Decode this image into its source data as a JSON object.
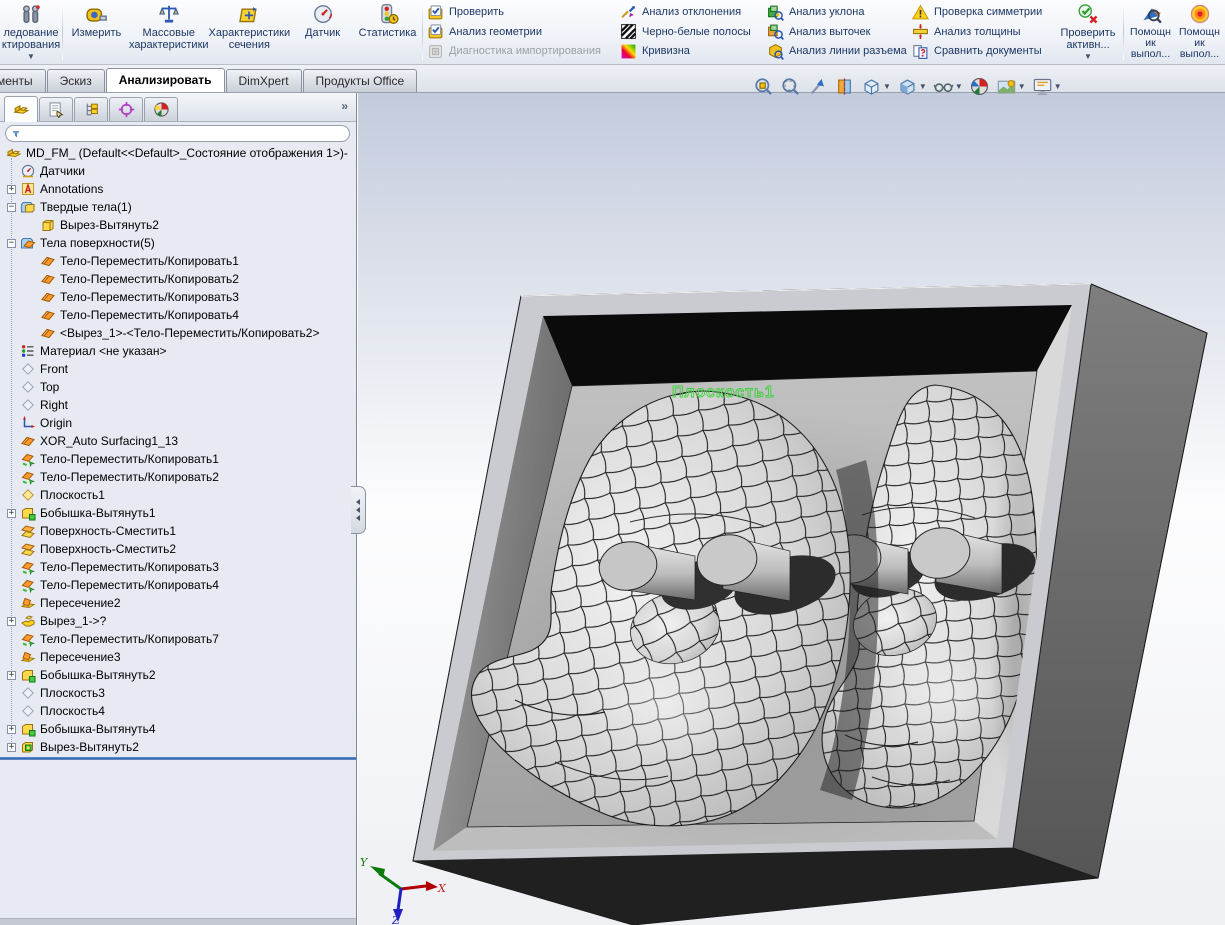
{
  "ribbon": {
    "groups": [
      {
        "type": "big",
        "buttons": [
          {
            "label": "ледование\nктирования",
            "icon": "design-study-icon",
            "dropdown": true
          }
        ]
      },
      {
        "type": "big",
        "buttons": [
          {
            "label": "Измерить",
            "icon": "measure-icon"
          },
          {
            "label": "Массовые\nхарактеристики",
            "icon": "mass-properties-icon"
          },
          {
            "label": "Характеристики\nсечения",
            "icon": "section-properties-icon"
          },
          {
            "label": "Датчик",
            "icon": "sensor-icon"
          },
          {
            "label": "Статистика",
            "icon": "statistics-icon"
          }
        ]
      },
      {
        "type": "stack",
        "buttons": [
          {
            "label": "Проверить",
            "icon": "check-icon"
          },
          {
            "label": "Анализ геометрии",
            "icon": "geometry-analysis-icon"
          },
          {
            "label": "Диагностика импортирования",
            "icon": "import-diagnostics-icon",
            "disabled": true
          }
        ]
      },
      {
        "type": "stack",
        "buttons": [
          {
            "label": "Анализ отклонения",
            "icon": "deviation-analysis-icon"
          },
          {
            "label": "Черно-белые полосы",
            "icon": "zebra-stripes-icon"
          },
          {
            "label": "Кривизна",
            "icon": "curvature-icon"
          }
        ]
      },
      {
        "type": "stack",
        "buttons": [
          {
            "label": "Анализ уклона",
            "icon": "draft-analysis-icon"
          },
          {
            "label": "Анализ выточек",
            "icon": "undercut-analysis-icon"
          },
          {
            "label": "Анализ линии разъема",
            "icon": "parting-line-analysis-icon"
          }
        ]
      },
      {
        "type": "stack",
        "buttons": [
          {
            "label": "Проверка симметрии",
            "icon": "symmetry-check-icon"
          },
          {
            "label": "Анализ толщины",
            "icon": "thickness-analysis-icon"
          },
          {
            "label": "Сравнить документы",
            "icon": "compare-documents-icon"
          }
        ]
      },
      {
        "type": "big",
        "buttons": [
          {
            "label": "Проверить\nактивн...",
            "icon": "check-active-icon",
            "dropdown": true
          }
        ]
      },
      {
        "type": "big",
        "buttons": [
          {
            "label": "Помощн\nик\nвыпол...",
            "icon": "helper-magnifier-icon"
          },
          {
            "label": "Помощн\nик\nвыпол...",
            "icon": "helper-target-icon"
          }
        ]
      }
    ]
  },
  "tabs": [
    {
      "label": "менты",
      "active": false
    },
    {
      "label": "Эскиз",
      "active": false
    },
    {
      "label": "Анализировать",
      "active": true
    },
    {
      "label": "DimXpert",
      "active": false
    },
    {
      "label": "Продукты Office",
      "active": false
    }
  ],
  "panel": {
    "tabs": [
      "featuremanager-icon",
      "propertymanager-icon",
      "configurationmanager-icon",
      "dimxpertmanager-icon",
      "displaymanager-icon"
    ],
    "overflow": "»",
    "root": {
      "label": "MD_FM_  (Default<<Default>_Состояние отображения 1>)-",
      "icon": "part-icon"
    },
    "items": [
      {
        "label": "Датчики",
        "icon": "sensors-icon",
        "indent": 1
      },
      {
        "label": "Annotations",
        "icon": "annotations-icon",
        "indent": 1,
        "expand": "plus"
      },
      {
        "label": "Твердые тела(1)",
        "icon": "solid-bodies-folder-icon",
        "indent": 1,
        "expand": "minus"
      },
      {
        "label": "Вырез-Вытянуть2",
        "icon": "solid-body-icon",
        "indent": 2
      },
      {
        "label": "Тела поверхности(5)",
        "icon": "surface-bodies-folder-icon",
        "indent": 1,
        "expand": "minus"
      },
      {
        "label": "Тело-Переместить/Копировать1",
        "icon": "surface-body-icon",
        "indent": 2
      },
      {
        "label": "Тело-Переместить/Копировать2",
        "icon": "surface-body-icon",
        "indent": 2
      },
      {
        "label": "Тело-Переместить/Копировать3",
        "icon": "surface-body-icon",
        "indent": 2
      },
      {
        "label": "Тело-Переместить/Копировать4",
        "icon": "surface-body-icon",
        "indent": 2
      },
      {
        "label": "<Вырез_1>-<Тело-Переместить/Копировать2>",
        "icon": "surface-body-icon",
        "indent": 2
      },
      {
        "label": "Материал <не указан>",
        "icon": "material-icon",
        "indent": 1
      },
      {
        "label": "Front",
        "icon": "plane-icon",
        "indent": 1
      },
      {
        "label": "Top",
        "icon": "plane-icon",
        "indent": 1
      },
      {
        "label": "Right",
        "icon": "plane-icon",
        "indent": 1
      },
      {
        "label": "Origin",
        "icon": "origin-icon",
        "indent": 1
      },
      {
        "label": "XOR_Auto Surfacing1_13",
        "icon": "surface-body-icon",
        "indent": 1
      },
      {
        "label": "Тело-Переместить/Копировать1",
        "icon": "move-copy-body-icon",
        "indent": 1
      },
      {
        "label": "Тело-Переместить/Копировать2",
        "icon": "move-copy-body-icon",
        "indent": 1
      },
      {
        "label": "Плоскость1",
        "icon": "ref-plane-icon",
        "indent": 1
      },
      {
        "label": "Бобышка-Вытянуть1",
        "icon": "boss-extrude-icon",
        "indent": 1,
        "expand": "plus"
      },
      {
        "label": "Поверхность-Сместить1",
        "icon": "offset-surface-icon",
        "indent": 1
      },
      {
        "label": "Поверхность-Сместить2",
        "icon": "offset-surface-icon",
        "indent": 1
      },
      {
        "label": "Тело-Переместить/Копировать3",
        "icon": "move-copy-body-icon",
        "indent": 1
      },
      {
        "label": "Тело-Переместить/Копировать4",
        "icon": "move-copy-body-icon",
        "indent": 1
      },
      {
        "label": "Пересечение2",
        "icon": "intersect-icon",
        "indent": 1
      },
      {
        "label": "Вырез_1->?",
        "icon": "cut-icon",
        "indent": 1,
        "expand": "plus"
      },
      {
        "label": "Тело-Переместить/Копировать7",
        "icon": "move-copy-body-icon",
        "indent": 1
      },
      {
        "label": "Пересечение3",
        "icon": "intersect-icon",
        "indent": 1
      },
      {
        "label": "Бобышка-Вытянуть2",
        "icon": "boss-extrude-icon",
        "indent": 1,
        "expand": "plus"
      },
      {
        "label": "Плоскость3",
        "icon": "plane-icon",
        "indent": 1
      },
      {
        "label": "Плоскость4",
        "icon": "plane-icon",
        "indent": 1
      },
      {
        "label": "Бобышка-Вытянуть4",
        "icon": "boss-extrude-icon",
        "indent": 1,
        "expand": "plus"
      },
      {
        "label": "Вырез-Вытянуть2",
        "icon": "cut-extrude-icon",
        "indent": 1,
        "expand": "plus"
      }
    ]
  },
  "viewport": {
    "headsup": [
      {
        "icon": "zoom-fit-icon",
        "dropdown": false
      },
      {
        "icon": "zoom-area-icon",
        "dropdown": false
      },
      {
        "icon": "previous-view-icon",
        "dropdown": false
      },
      {
        "icon": "section-view-icon",
        "dropdown": false
      },
      {
        "icon": "view-orientation-icon",
        "dropdown": true
      },
      {
        "icon": "display-style-icon",
        "dropdown": true
      },
      {
        "icon": "hide-show-items-icon",
        "dropdown": true
      },
      {
        "icon": "edit-appearance-icon",
        "dropdown": false
      },
      {
        "icon": "apply-scene-icon",
        "dropdown": true
      },
      {
        "icon": "view-settings-icon",
        "dropdown": true
      }
    ],
    "plane_label": "Плоскость1",
    "triad": {
      "x": "X",
      "y": "Y",
      "z": "Z"
    }
  },
  "colors": {
    "plane_label_green": "#3bd33b",
    "rollback_blue": "#2c5fa8",
    "ribbon_text": "#1c3764",
    "triad_x_red": "#b00000",
    "triad_y_green": "#0a7a0a",
    "triad_z_blue": "#2020c0"
  }
}
